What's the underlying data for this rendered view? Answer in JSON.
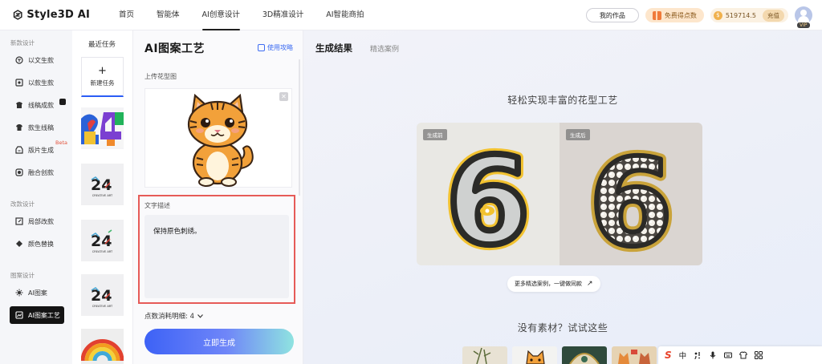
{
  "brand": {
    "name": "Style3D AI"
  },
  "nav": [
    {
      "label": "首页",
      "active": false
    },
    {
      "label": "智能体",
      "active": false
    },
    {
      "label": "AI创意设计",
      "active": true
    },
    {
      "label": "3D精准设计",
      "active": false
    },
    {
      "label": "AI智能商拍",
      "active": false
    }
  ],
  "header": {
    "my_works": "我的作品",
    "free_points": "免费得点数",
    "points": "519714.5",
    "recharge": "充值",
    "vip": "VIP"
  },
  "sidebar": {
    "sections": [
      {
        "title": "新款设计",
        "items": [
          {
            "label": "以文生款",
            "icon": "text-to-design-icon"
          },
          {
            "label": "以款生款",
            "icon": "design-to-design-icon"
          },
          {
            "label": "线稿成款",
            "icon": "lineart-icon"
          },
          {
            "label": "款生线稿",
            "icon": "shirt-icon"
          },
          {
            "label": "版片生成",
            "icon": "pattern-piece-icon",
            "badge": "Beta"
          },
          {
            "label": "融合创款",
            "icon": "fusion-icon"
          }
        ]
      },
      {
        "title": "改款设计",
        "items": [
          {
            "label": "局部改款",
            "icon": "partial-edit-icon"
          },
          {
            "label": "颜色替换",
            "icon": "color-replace-icon"
          }
        ]
      },
      {
        "title": "图案设计",
        "items": [
          {
            "label": "AI图案",
            "icon": "ai-pattern-icon"
          },
          {
            "label": "AI图案工艺",
            "icon": "pattern-craft-icon",
            "active": true
          }
        ]
      }
    ]
  },
  "recent": {
    "title": "最近任务",
    "new_task": "新建任务",
    "thumb_caption": "CREATIVE ART",
    "thumb_number": "24"
  },
  "tool": {
    "title": "AI图案工艺",
    "guide": "使用攻略",
    "upload_label": "上传花型图",
    "desc_label": "文字描述",
    "desc_value": "保持原色刺绣。",
    "points_label": "点数消耗明细: 4",
    "generate": "立即生成"
  },
  "result": {
    "tab_main": "生成结果",
    "tab_sub": "精选案例",
    "slogan": "轻松实现丰富的花型工艺",
    "before_badge": "生成前",
    "after_badge": "生成后",
    "before_digit": "6",
    "after_digit": "6",
    "more_cases": "更多精选案例，一键做同款",
    "no_material": "没有素材？试试这些"
  },
  "ime": {
    "mode": "中"
  },
  "colors": {
    "accent": "#3d62f6",
    "highlight": "#e65b58",
    "active_bg": "#141414"
  }
}
